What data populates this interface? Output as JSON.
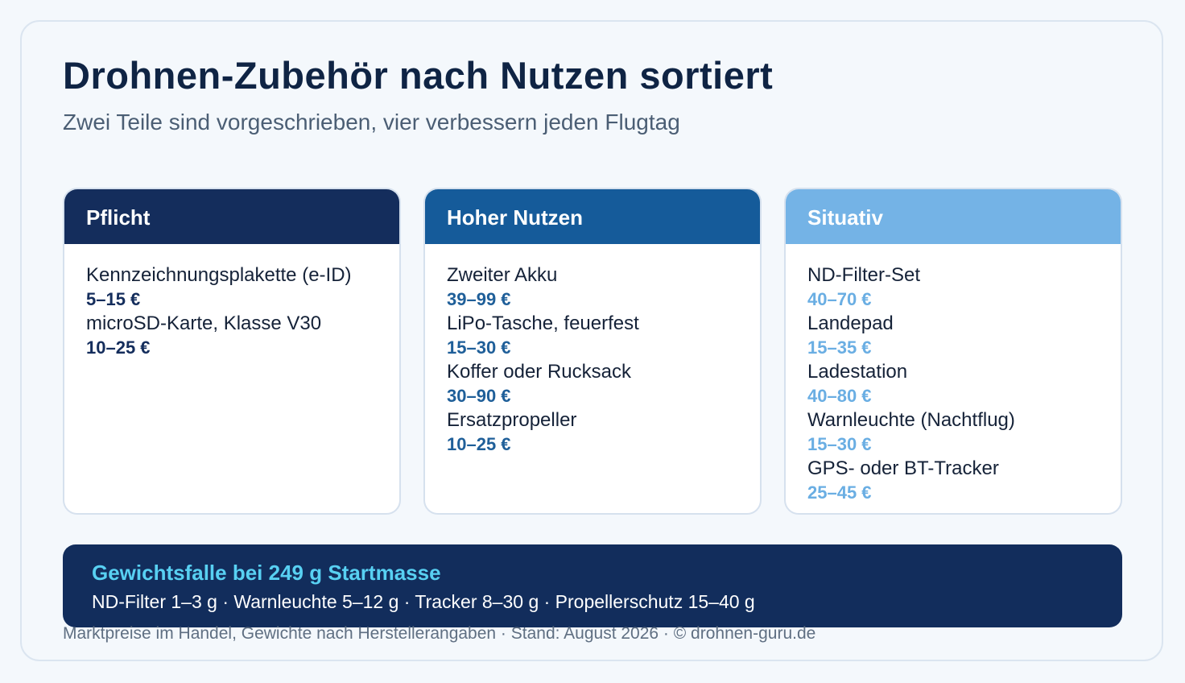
{
  "header": {
    "title": "Drohnen-Zubehör nach Nutzen sortiert",
    "subtitle": "Zwei Teile sind vorgeschrieben, vier verbessern jeden Flugtag"
  },
  "colors": {
    "pflicht": "#142d5c",
    "hoher_nutzen": "#155b9a",
    "situativ": "#74b3e6",
    "banner_accent": "#58d0f2"
  },
  "categories": [
    {
      "title": "Pflicht",
      "items": [
        {
          "name": "Kennzeichnungsplakette (e-ID)",
          "price": "5–15 €"
        },
        {
          "name": "microSD-Karte, Klasse V30",
          "price": "10–25 €"
        }
      ]
    },
    {
      "title": "Hoher Nutzen",
      "items": [
        {
          "name": "Zweiter Akku",
          "price": "39–99 €"
        },
        {
          "name": "LiPo-Tasche, feuerfest",
          "price": "15–30 €"
        },
        {
          "name": "Koffer oder Rucksack",
          "price": "30–90 €"
        },
        {
          "name": "Ersatzpropeller",
          "price": "10–25 €"
        }
      ]
    },
    {
      "title": "Situativ",
      "items": [
        {
          "name": "ND-Filter-Set",
          "price": "40–70 €"
        },
        {
          "name": "Landepad",
          "price": "15–35 €"
        },
        {
          "name": "Ladestation",
          "price": "40–80 €"
        },
        {
          "name": "Warnleuchte (Nachtflug)",
          "price": "15–30 €"
        },
        {
          "name": "GPS- oder BT-Tracker",
          "price": "25–45 €"
        }
      ]
    }
  ],
  "banner": {
    "title": "Gewichtsfalle bei 249 g Startmasse",
    "text": "ND-Filter 1–3 g · Warnleuchte 5–12 g · Tracker 8–30 g · Propellerschutz 15–40 g"
  },
  "footer": "Marktpreise im Handel, Gewichte nach Herstellerangaben · Stand: August 2026 · © drohnen-guru.de"
}
